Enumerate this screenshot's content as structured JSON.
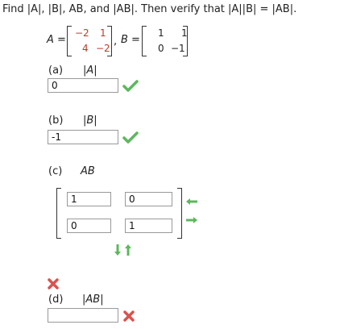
{
  "problem": {
    "statement": "Find |A|, |B|, AB, and |AB|. Then verify that |A||B| = |AB|.",
    "A_label": "A =",
    "B_label": "B =",
    "A_entries": [
      "−2",
      "1",
      "4",
      "−2"
    ],
    "B_entries": [
      "1",
      "1",
      "0",
      "−1"
    ],
    "comma": ","
  },
  "part_a": {
    "label": "(a)",
    "expr": "|A|",
    "answer": "0",
    "status": "correct"
  },
  "part_b": {
    "label": "(b)",
    "expr": "|B|",
    "answer": "-1",
    "status": "correct"
  },
  "part_c": {
    "label": "(c)",
    "expr": "AB",
    "entries": [
      "1",
      "0",
      "0",
      "1"
    ],
    "status": "incorrect"
  },
  "part_d": {
    "label": "(d)",
    "expr": "|AB|",
    "answer": "",
    "status": "incorrect"
  },
  "colors": {
    "correct": "#5cb85c",
    "incorrect": "#d9534f",
    "negative_entry": "#c0392b"
  }
}
